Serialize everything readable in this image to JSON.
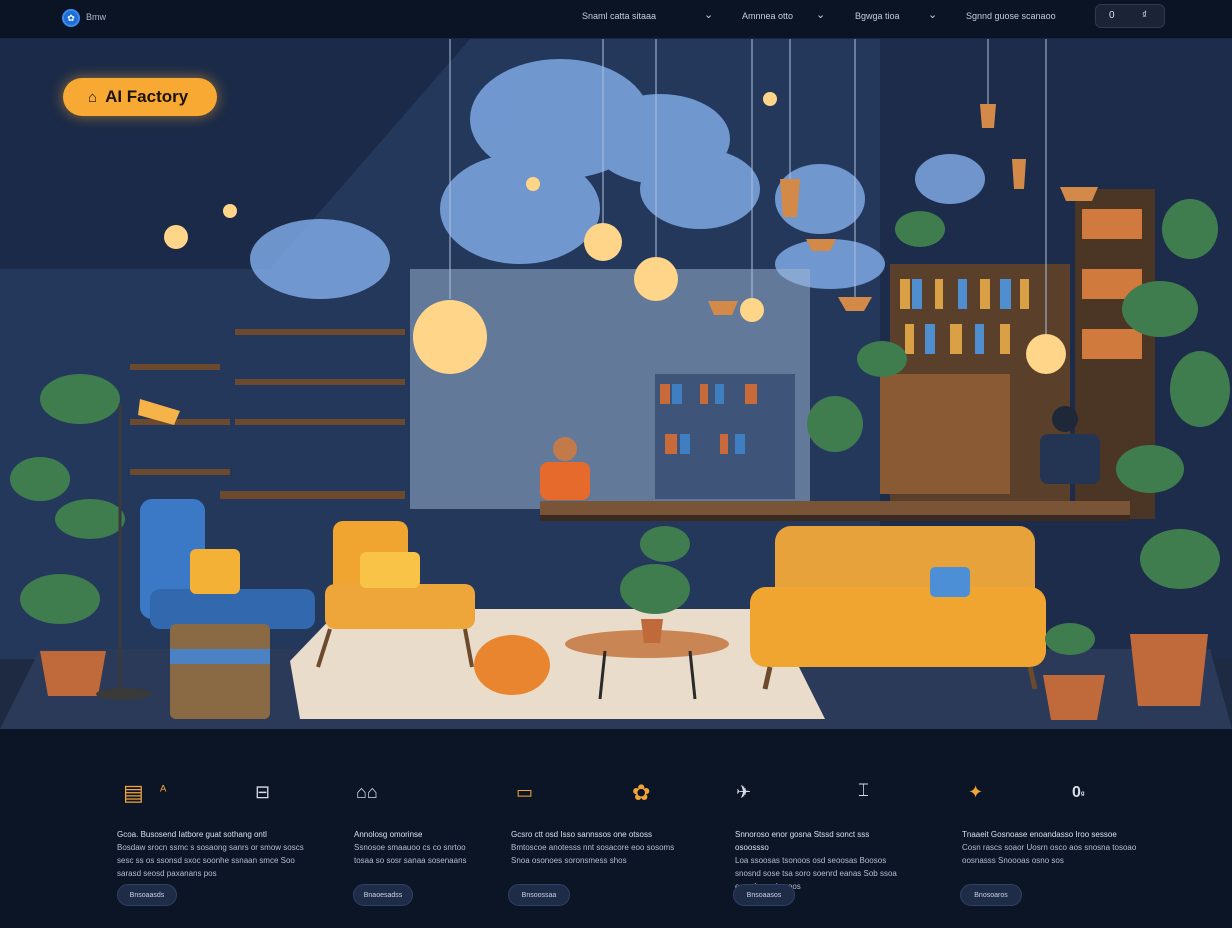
{
  "nav": {
    "brand": "Bmw",
    "items": [
      "Snaml catta sitaaa",
      "Amnnea otto",
      "Bgwga tioa",
      "Sgnnd guose scanaoo"
    ],
    "button_left": "0",
    "button_right": "₫"
  },
  "hero": {
    "badge_label": "AI Factory",
    "colors": {
      "badge": "#f7a933",
      "sofa": "#f0a531",
      "chair_blue": "#3b79c7"
    }
  },
  "features": [
    {
      "icon": "ticket-icon",
      "glyph": "📋",
      "title": "Gcoa. Busosend Iatbore guat sothang ontl",
      "body": "Bosdaw srocn ssmc s sosaong sanrs or smow soscs sesc ss os ssonsd sxoc soonhe ssnaan smce Soo sarasd seosd paxanans pos",
      "button": "Bnsoaasds"
    },
    {
      "icon": "ruler-icon",
      "glyph": "✏",
      "title": "Annolosg omorinse",
      "body": "Ssnosoe smaauoo cs co snrtoo tosaa so sosr sanaa sosenaans",
      "button": "Bnaoesadss"
    },
    {
      "icon": "car-icon",
      "glyph": "🚗",
      "title": "Gcsro ctt osd Isso sannssos one otsoss",
      "body": "Bmtoscoe anotesss nnt sosacore eoo sosoms Snoa osonoes soronsmess shos",
      "button": "Bnsoossaa"
    },
    {
      "icon": "plane-icon",
      "glyph": "✈",
      "title": "Snnoroso enor gosna Stssd sonct sss osoossso",
      "body": "Loa ssoosas tsonoos osd seoosas Boosos snosnd sose tsa soro soenrd eanas Sob ssoa eoss I ocs d ssoos",
      "button": "Bnsoaasos"
    },
    {
      "icon": "tool-icon",
      "glyph": "🔧",
      "title": "Tnaaeit Gosnoase enoandasso Iroo sessoe",
      "body": "Cosn rascs soaor Uosrn osco aos snosna tosoao oosnasss Snoooas osno sos",
      "button": "Bnosoaros"
    }
  ],
  "extra_icons": [
    {
      "name": "flowers-icon",
      "glyph": "✿"
    },
    {
      "name": "sparkles-icon",
      "glyph": "✦"
    },
    {
      "name": "zero-icon",
      "glyph": "0"
    }
  ]
}
